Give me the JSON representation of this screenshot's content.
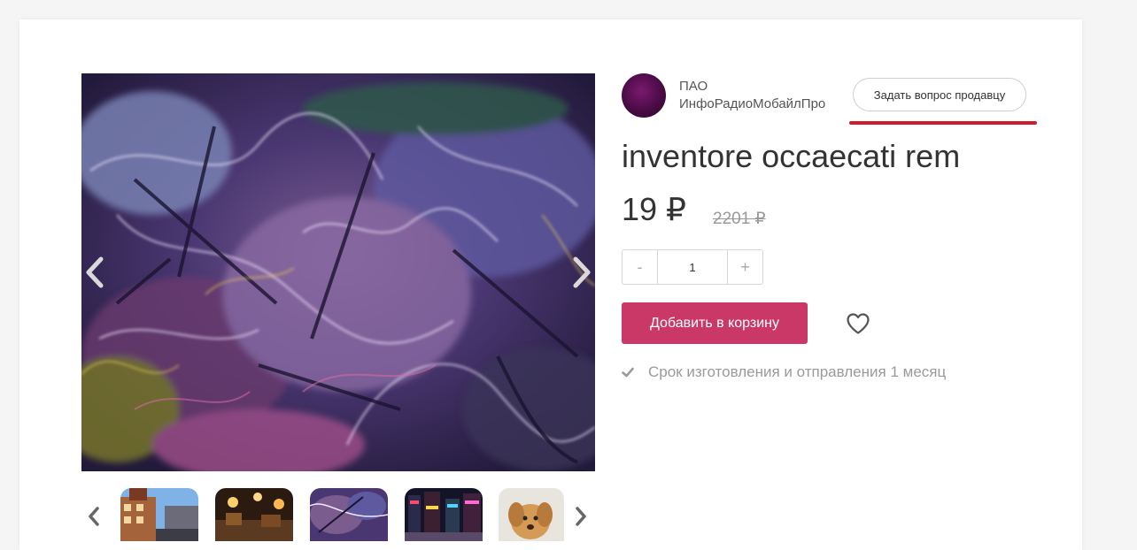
{
  "seller": {
    "name_line1": "ПАО",
    "name_line2": "ИнфоРадиоМобайлПро",
    "ask_button": "Задать вопрос продавцу"
  },
  "product": {
    "title": "inventore occaecati rem",
    "price": "19 ₽",
    "old_price": "2201 ₽",
    "quantity": "1",
    "qty_minus": "-",
    "qty_plus": "+",
    "add_to_cart": "Добавить в корзину",
    "delivery_note": "Срок изготовления и отправления 1 месяц"
  },
  "gallery": {
    "thumbnails": [
      "building-street-photo",
      "restaurant-night-photo",
      "abstract-purple-art",
      "city-night-lights-photo",
      "puppy-photo"
    ]
  },
  "colors": {
    "accent": "#c93866",
    "underline": "#d01c2e",
    "text": "#333333",
    "muted": "#9a9a9a"
  },
  "icons": {
    "gallery_prev": "chevron-left-icon",
    "gallery_next": "chevron-right-icon",
    "favorite": "heart-icon",
    "delivery": "check-icon"
  }
}
